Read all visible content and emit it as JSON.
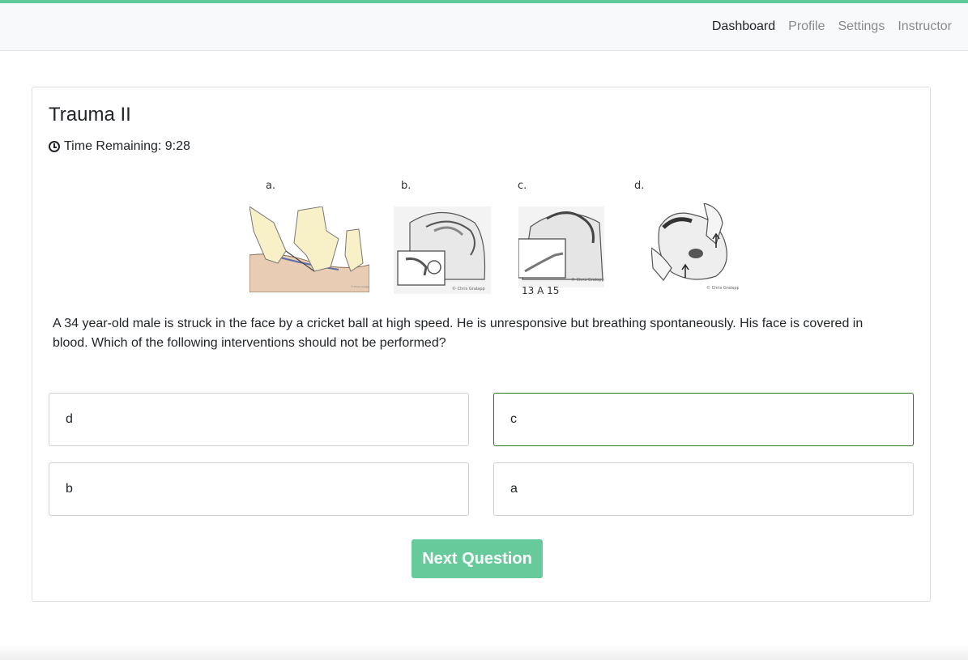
{
  "nav": {
    "items": [
      {
        "label": "Dashboard",
        "active": true
      },
      {
        "label": "Profile",
        "active": false
      },
      {
        "label": "Settings",
        "active": false
      },
      {
        "label": "Instructor",
        "active": false
      }
    ]
  },
  "quiz": {
    "title": "Trauma II",
    "timer_text": "Time Remaining: 9:28",
    "figure": {
      "labels": [
        "a.",
        "b.",
        "c.",
        "d."
      ],
      "caption_partial": "13 A 15",
      "credit": "© Chris Gralapp"
    },
    "question": "A 34 year-old male is struck in the face by a cricket ball at high speed. He is unresponsive but breathing spontaneously. His face is covered in blood. Which of the following interventions should not be performed?",
    "answers": [
      {
        "label": "d",
        "selected": false
      },
      {
        "label": "c",
        "selected": true
      },
      {
        "label": "b",
        "selected": false
      },
      {
        "label": "a",
        "selected": false
      }
    ],
    "next_button": "Next Question"
  },
  "colors": {
    "accent": "#66ca9a",
    "top_line": "#5fc99a",
    "selected_border": "#2d7a1f"
  }
}
